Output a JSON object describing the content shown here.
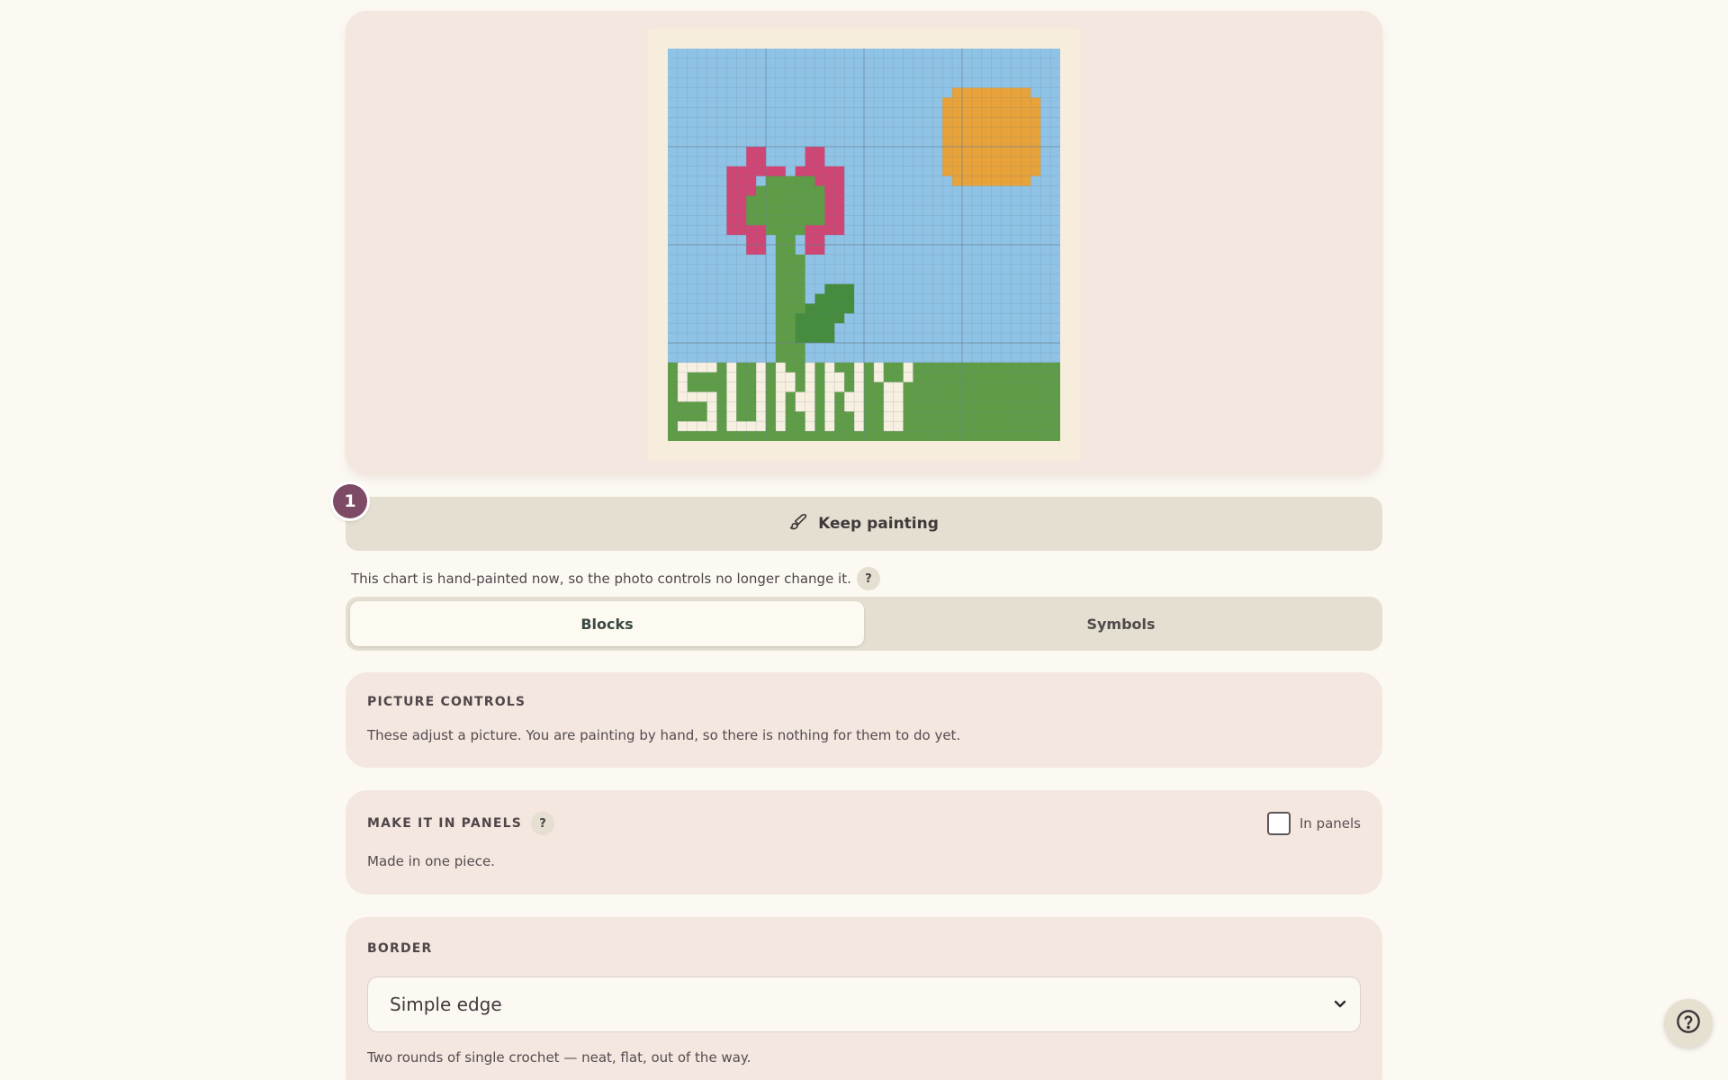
{
  "preview": {
    "chart_label": "SUNNY",
    "colors": {
      "sky": "#8fc3e6",
      "grass": "#5f9c47",
      "stem": "#5f9c47",
      "leaf": "#458c3c",
      "petal": "#cf4574",
      "sun": "#e8a23a",
      "text": "#f7f0e1",
      "grid": "#6c7f8f"
    }
  },
  "step": "1",
  "keep_painting": {
    "label": "Keep painting",
    "icon": "paintbrush-icon"
  },
  "note": {
    "text": "This chart is hand-painted now, so the photo controls no longer change it.",
    "help": "?"
  },
  "tabs": [
    {
      "label": "Blocks",
      "active": true
    },
    {
      "label": "Symbols",
      "active": false
    }
  ],
  "picture_controls": {
    "title": "PICTURE CONTROLS",
    "text": "These adjust a picture. You are painting by hand, so there is nothing for them to do yet."
  },
  "panels": {
    "title": "MAKE IT IN PANELS",
    "help": "?",
    "checkbox_label": "In panels",
    "checked": false,
    "text": "Made in one piece."
  },
  "border": {
    "title": "BORDER",
    "selected": "Simple edge",
    "text": "Two rounds of single crochet — neat, flat, out of the way."
  },
  "help_fab": {
    "icon": "help-circle-icon"
  }
}
